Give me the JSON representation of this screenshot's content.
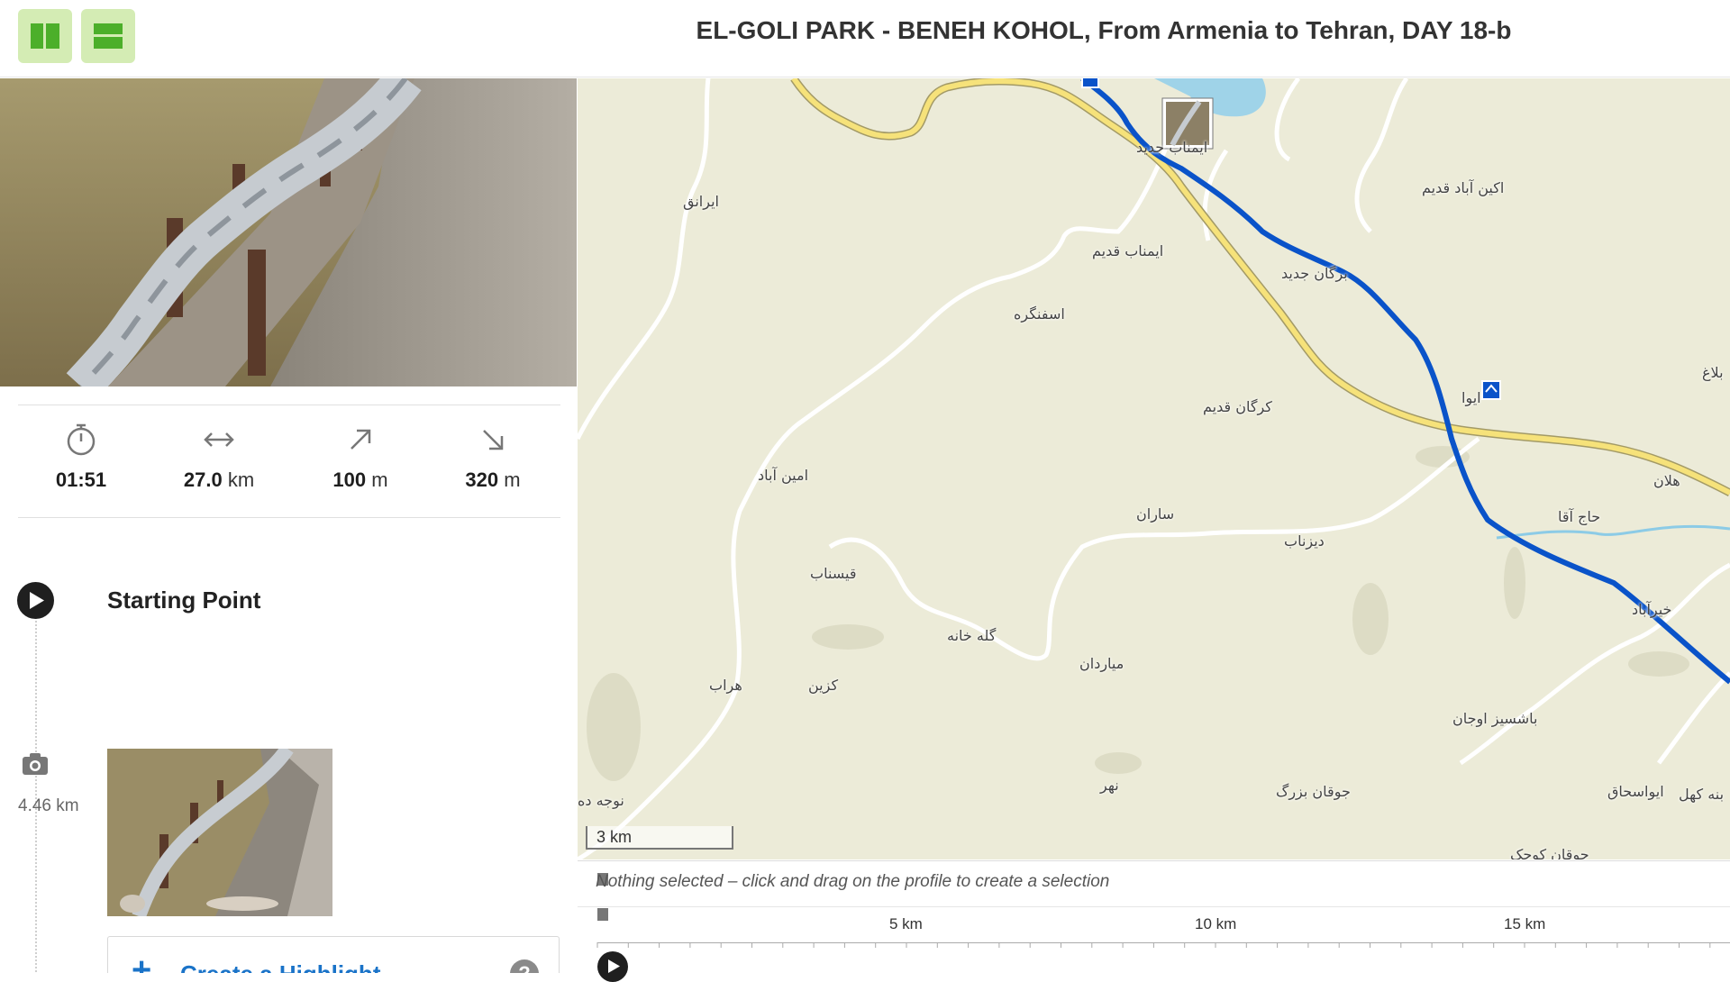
{
  "header": {
    "title": "EL-GOLI PARK - BENEH KOHOL, From Armenia to Tehran, DAY 18-b",
    "layout_buttons": [
      "columns-layout-icon",
      "rows-layout-icon"
    ],
    "accent_color": "#d4ecb4",
    "icon_color": "#4caf2a"
  },
  "stats": {
    "duration": {
      "icon": "stopwatch-icon",
      "value": "01:51",
      "unit": ""
    },
    "distance": {
      "icon": "horizontal-arrows-icon",
      "value": "27.0",
      "unit": "km"
    },
    "uphill": {
      "icon": "arrow-up-right-icon",
      "value": "100",
      "unit": "m"
    },
    "downhill": {
      "icon": "arrow-down-right-icon",
      "value": "320",
      "unit": "m"
    }
  },
  "timeline": {
    "start_label": "Starting Point",
    "photo_distance": "4.46 km",
    "create_highlight_label": "Create a Highlight",
    "help_label": "?"
  },
  "map": {
    "route_color": "#0a53c9",
    "scale_label": "3 km",
    "places": [
      "ایرانق",
      "ایمناب قدیم",
      "اسفنگره",
      "برگان جدید",
      "اکین آباد قدیم",
      "کرگان قدیم",
      "امین آباد",
      "ساران",
      "دیزناب",
      "قیسناب",
      "گله خانه",
      "میاردان",
      "کزین",
      "هراب",
      "حاج آقا",
      "هلان",
      "خیرآباد",
      "باشسیز اوجان",
      "جوقان بزرگ",
      "ایواسحاق",
      "بنه کهل",
      "نهر",
      "نوجه ده",
      "بلاغ",
      "جوقان کوچک",
      "ایمناب جدید",
      "ایوا"
    ]
  },
  "profile": {
    "message": "Nothing selected – click and drag on the profile to create a selection",
    "km_labels": [
      "5 km",
      "10 km",
      "15 km"
    ]
  }
}
